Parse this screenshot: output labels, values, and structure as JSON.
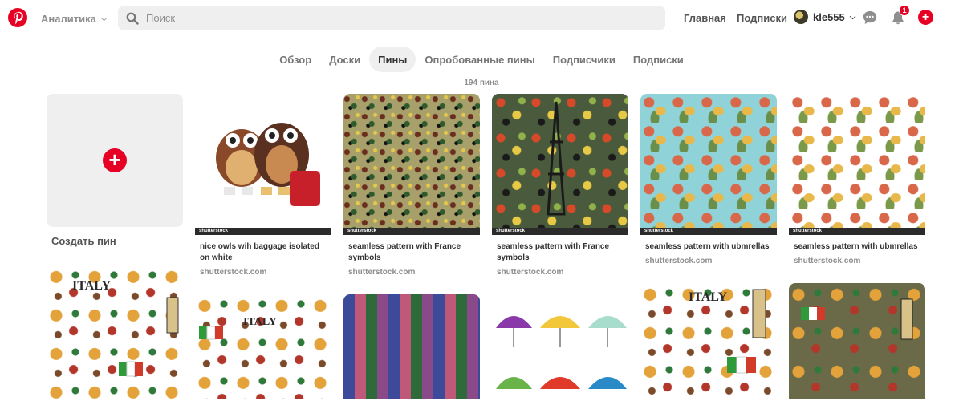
{
  "header": {
    "analytics_label": "Аналитика",
    "search_placeholder": "Поиск",
    "home_label": "Главная",
    "following_label": "Подписки",
    "username": "kle555",
    "notification_count": "1"
  },
  "tabs": [
    {
      "label": "Обзор",
      "active": false
    },
    {
      "label": "Доски",
      "active": false
    },
    {
      "label": "Пины",
      "active": true
    },
    {
      "label": "Опробованные пины",
      "active": false
    },
    {
      "label": "Подписчики",
      "active": false
    },
    {
      "label": "Подписки",
      "active": false
    }
  ],
  "pin_count": "194 пина",
  "create_pin_label": "Создать пин",
  "watermark": "shutterstock",
  "pins_row1": [
    {
      "title": "nice owls wih baggage isolated on white",
      "source": "shutterstock.com",
      "pattern": "owls"
    },
    {
      "title": "seamless pattern with France symbols",
      "source": "shutterstock.com",
      "pattern": "france1"
    },
    {
      "title": "seamless pattern with France symbols",
      "source": "shutterstock.com",
      "pattern": "france2"
    },
    {
      "title": "seamless pattern with ubmrellas",
      "source": "shutterstock.com",
      "pattern": "umb-blue"
    },
    {
      "title": "seamless pattern with ubmrellas",
      "source": "shutterstock.com",
      "pattern": "umb-white"
    }
  ],
  "italy_text": "ITALY",
  "colors": {
    "brand": "#e60023",
    "tab_active_bg": "#efefef",
    "search_bg": "#efefef"
  }
}
